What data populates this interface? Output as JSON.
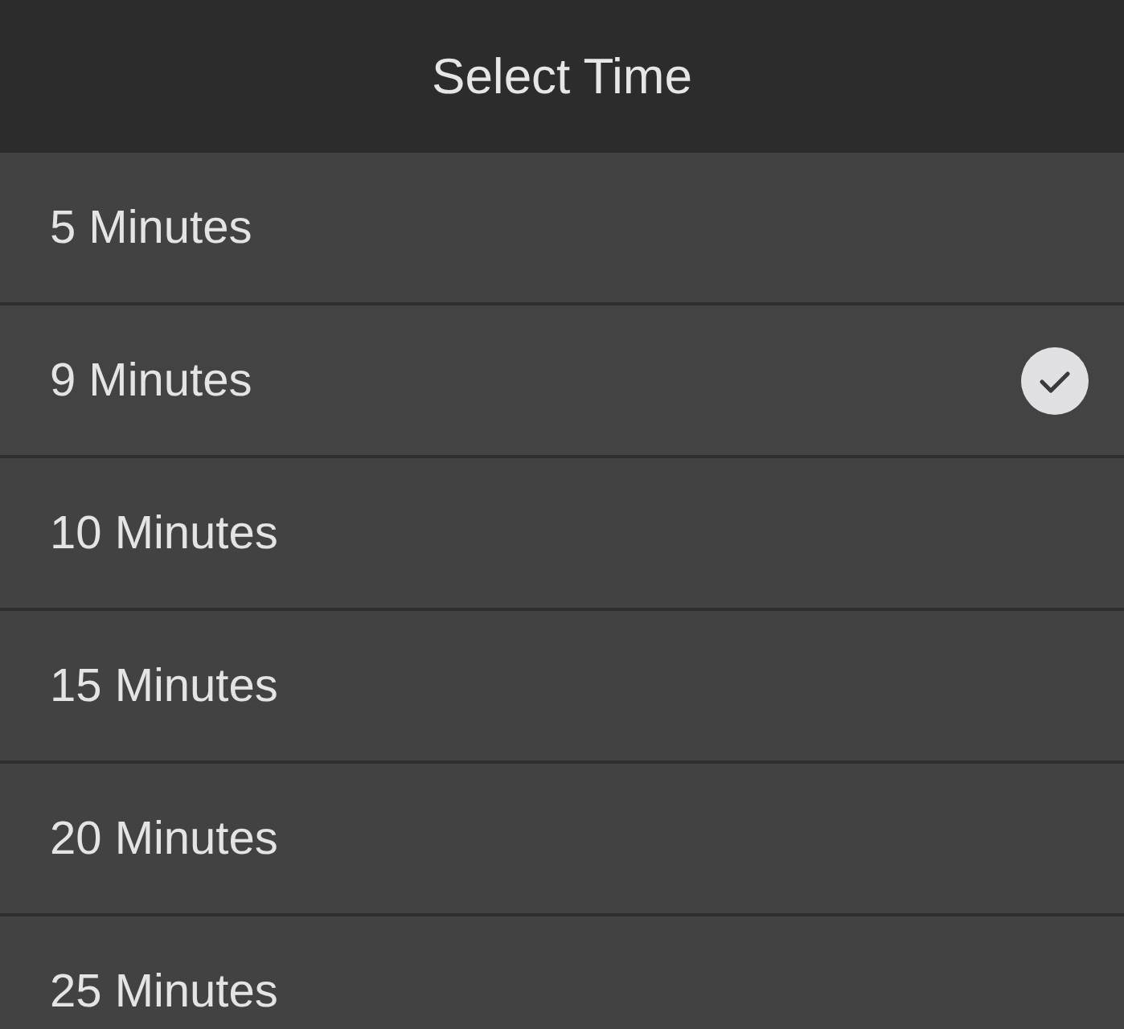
{
  "title": "Select Time",
  "options": [
    {
      "label": "5 Minutes",
      "selected": false
    },
    {
      "label": "9 Minutes",
      "selected": true
    },
    {
      "label": "10 Minutes",
      "selected": false
    },
    {
      "label": "15 Minutes",
      "selected": false
    },
    {
      "label": "20 Minutes",
      "selected": false
    },
    {
      "label": "25 Minutes",
      "selected": false
    }
  ]
}
